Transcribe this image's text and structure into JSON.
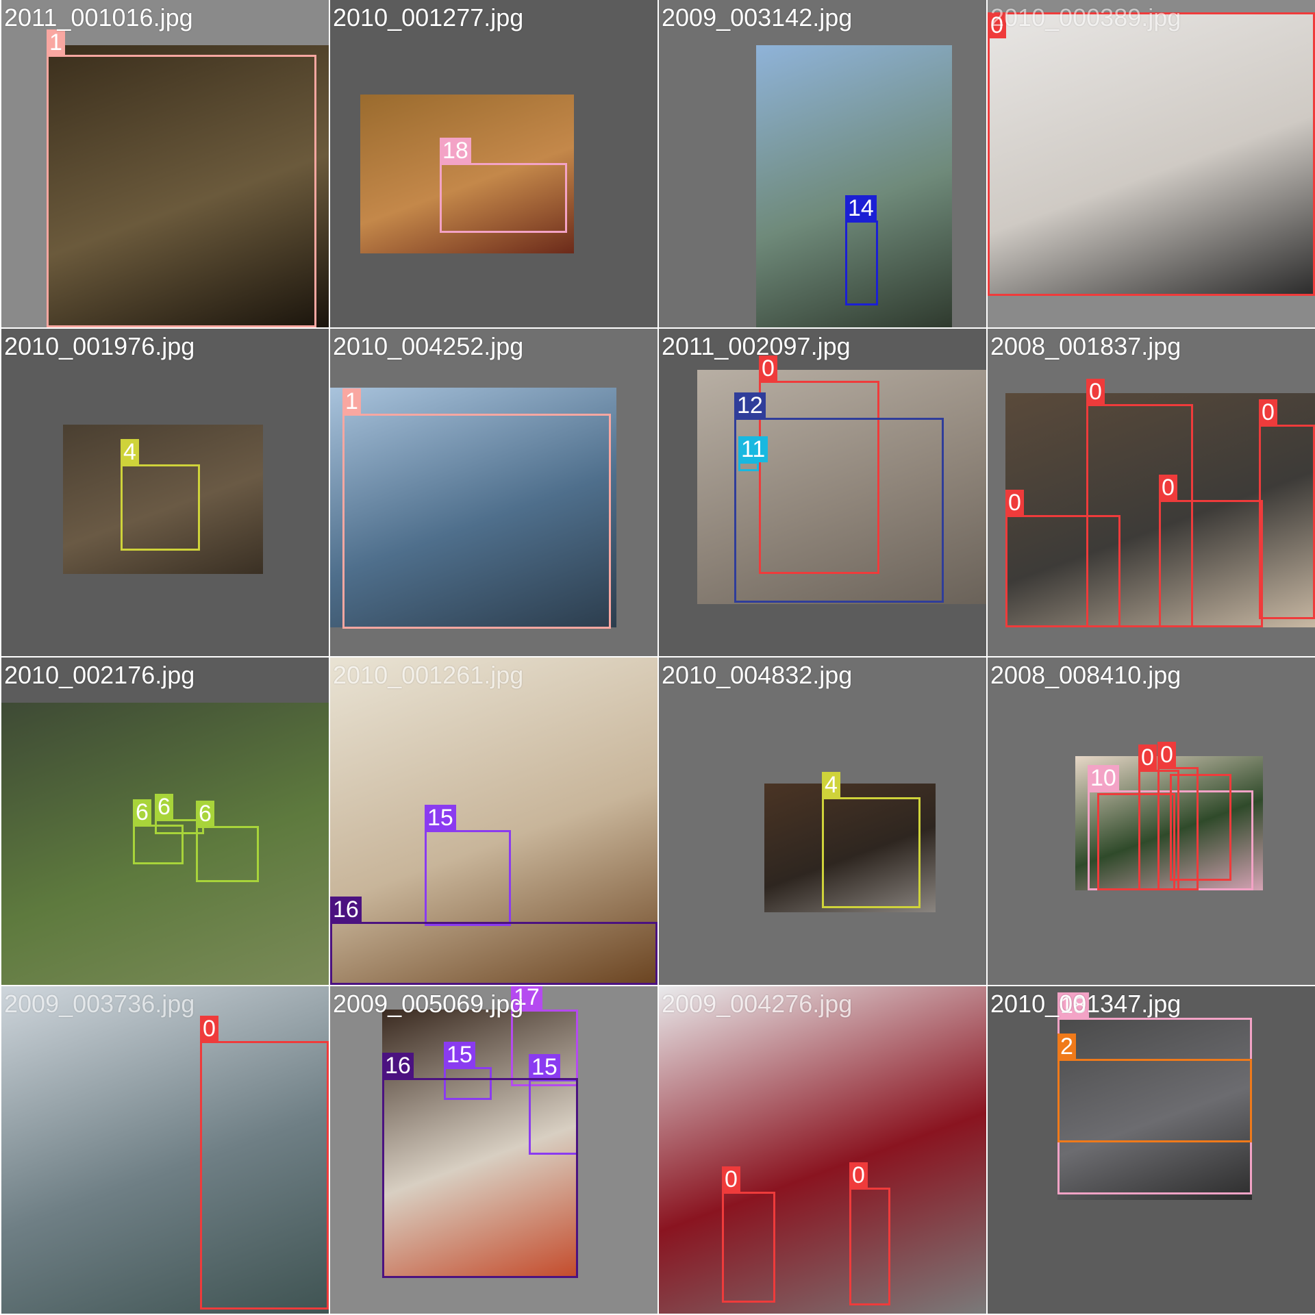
{
  "tiles": [
    {
      "filename": "2011_001016.jpg",
      "bg": "#8a8a8a",
      "photo": [
        "#3a2e1c",
        "#6b5a3c",
        "#1a140c"
      ],
      "boxes": [
        {
          "class": "1",
          "color": "#f9a7a1"
        }
      ]
    },
    {
      "filename": "2010_001277.jpg",
      "bg": "#5c5c5c",
      "photo": [
        "#9a6b2e",
        "#c4884a",
        "#6b2a1a"
      ],
      "boxes": [
        {
          "class": "18",
          "color": "#f3a3c6"
        }
      ]
    },
    {
      "filename": "2009_003142.jpg",
      "bg": "#707070",
      "photo": [
        "#8fb3d9",
        "#6f8a7a",
        "#2f3a2e"
      ],
      "boxes": [
        {
          "class": "14",
          "color": "#1b1fd4"
        }
      ]
    },
    {
      "filename": "2010_000389.jpg",
      "bg": "#8a8a8a",
      "photo": [
        "#e8e6e4",
        "#cfcac4",
        "#2a2a2a"
      ],
      "boxes": [
        {
          "class": "0",
          "color": "#ef3b3b"
        }
      ]
    },
    {
      "filename": "2010_001976.jpg",
      "bg": "#5c5c5c",
      "photo": [
        "#4a3f31",
        "#6a5a45",
        "#3a3024"
      ],
      "boxes": [
        {
          "class": "4",
          "color": "#cfd33a"
        }
      ]
    },
    {
      "filename": "2010_004252.jpg",
      "bg": "#707070",
      "photo": [
        "#a9c3dc",
        "#4f6f8c",
        "#2c3d4d"
      ],
      "boxes": [
        {
          "class": "1",
          "color": "#f9a7a1"
        }
      ]
    },
    {
      "filename": "2011_002097.jpg",
      "bg": "#5c5c5c",
      "photo": [
        "#b8afa4",
        "#8f857a",
        "#6a6259"
      ],
      "boxes": [
        {
          "class": "0",
          "color": "#ef3b3b"
        },
        {
          "class": "12",
          "color": "#2f3d9a"
        },
        {
          "class": "11",
          "color": "#18b8e0"
        }
      ]
    },
    {
      "filename": "2008_001837.jpg",
      "bg": "#707070",
      "photo": [
        "#5a4a3a",
        "#3d3b38",
        "#c9b9a4"
      ],
      "boxes": [
        {
          "class": "0",
          "color": "#ef3b3b"
        },
        {
          "class": "0",
          "color": "#ef3b3b"
        },
        {
          "class": "0",
          "color": "#ef3b3b"
        },
        {
          "class": "0",
          "color": "#ef3b3b"
        },
        {
          "class": "0",
          "color": "#ef3b3b"
        }
      ]
    },
    {
      "filename": "2010_002176.jpg",
      "bg": "#5c5c5c",
      "photo": [
        "#3e4a35",
        "#5e7a3e",
        "#7a8a58"
      ],
      "boxes": [
        {
          "class": "6",
          "color": "#a8d43a"
        },
        {
          "class": "6",
          "color": "#a8d43a"
        },
        {
          "class": "6",
          "color": "#a8d43a"
        }
      ]
    },
    {
      "filename": "2010_001261.jpg",
      "bg": "#707070",
      "photo": [
        "#e9e3d4",
        "#c8b59a",
        "#6a4320"
      ],
      "boxes": [
        {
          "class": "15",
          "color": "#8a3bf0"
        },
        {
          "class": "16",
          "color": "#4b1280"
        }
      ]
    },
    {
      "filename": "2010_004832.jpg",
      "bg": "#707070",
      "photo": [
        "#4a3424",
        "#2e2620",
        "#8a8580"
      ],
      "boxes": [
        {
          "class": "4",
          "color": "#cfd33a"
        }
      ]
    },
    {
      "filename": "2008_008410.jpg",
      "bg": "#707070",
      "photo": [
        "#e8d8c8",
        "#2f4a2a",
        "#d6a3b5"
      ],
      "boxes": [
        {
          "class": "10",
          "color": "#f3a3c6"
        },
        {
          "class": "0",
          "color": "#ef3b3b"
        },
        {
          "class": "0",
          "color": "#ef3b3b"
        },
        {
          "class": "0",
          "color": "#ef3b3b"
        },
        {
          "class": "0",
          "color": "#ef3b3b"
        }
      ]
    },
    {
      "filename": "2009_003736.jpg",
      "bg": "#8a8a8a",
      "photo": [
        "#cfd6dc",
        "#6f7f85",
        "#3f5352"
      ],
      "boxes": [
        {
          "class": "0",
          "color": "#ef3b3b"
        }
      ]
    },
    {
      "filename": "2009_005069.jpg",
      "bg": "#8a8a8a",
      "photo": [
        "#3a2a20",
        "#d8cfc2",
        "#c44a2a"
      ],
      "boxes": [
        {
          "class": "17",
          "color": "#b54af0"
        },
        {
          "class": "15",
          "color": "#8a3bf0"
        },
        {
          "class": "15",
          "color": "#8a3bf0"
        },
        {
          "class": "16",
          "color": "#4b1280"
        },
        {
          "class": "15",
          "color": "#8a3bf0"
        }
      ]
    },
    {
      "filename": "2009_004276.jpg",
      "bg": "#8a8a8a",
      "photo": [
        "#e9eaec",
        "#8a1420",
        "#7a7a7a"
      ],
      "boxes": [
        {
          "class": "0",
          "color": "#ef3b3b"
        },
        {
          "class": "0",
          "color": "#ef3b3b"
        }
      ]
    },
    {
      "filename": "2010_001347.jpg",
      "bg": "#5c5c5c",
      "photo": [
        "#4a4a4a",
        "#6c6c70",
        "#2c2c2c"
      ],
      "boxes": [
        {
          "class": "18",
          "color": "#f3a3c6"
        },
        {
          "class": "2",
          "color": "#f07a1a"
        }
      ]
    }
  ]
}
